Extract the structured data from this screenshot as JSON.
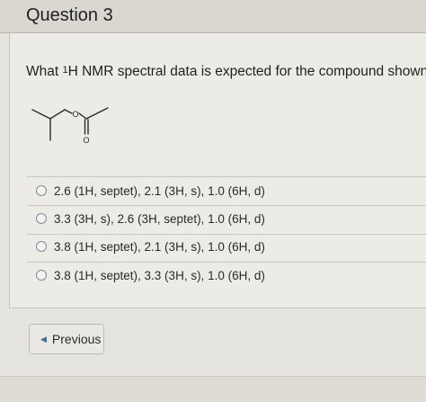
{
  "header": {
    "title": "Question 3"
  },
  "question": {
    "prefix": "What ",
    "superscript": "1",
    "suffix": "H NMR spectral data is expected for the compound shown?",
    "molecule": {
      "oxygen_label": "O",
      "carbonyl_label": "O"
    }
  },
  "options": [
    {
      "label": "2.6 (1H, septet), 2.1 (3H, s), 1.0 (6H, d)"
    },
    {
      "label": "3.3 (3H, s), 2.6 (3H, septet), 1.0 (6H, d)"
    },
    {
      "label": "3.8 (1H, septet), 2.1 (3H, s), 1.0 (6H, d)"
    },
    {
      "label": "3.8 (1H, septet), 3.3 (3H, s), 1.0 (6H, d)"
    }
  ],
  "navigation": {
    "previous_label": "Previous"
  }
}
